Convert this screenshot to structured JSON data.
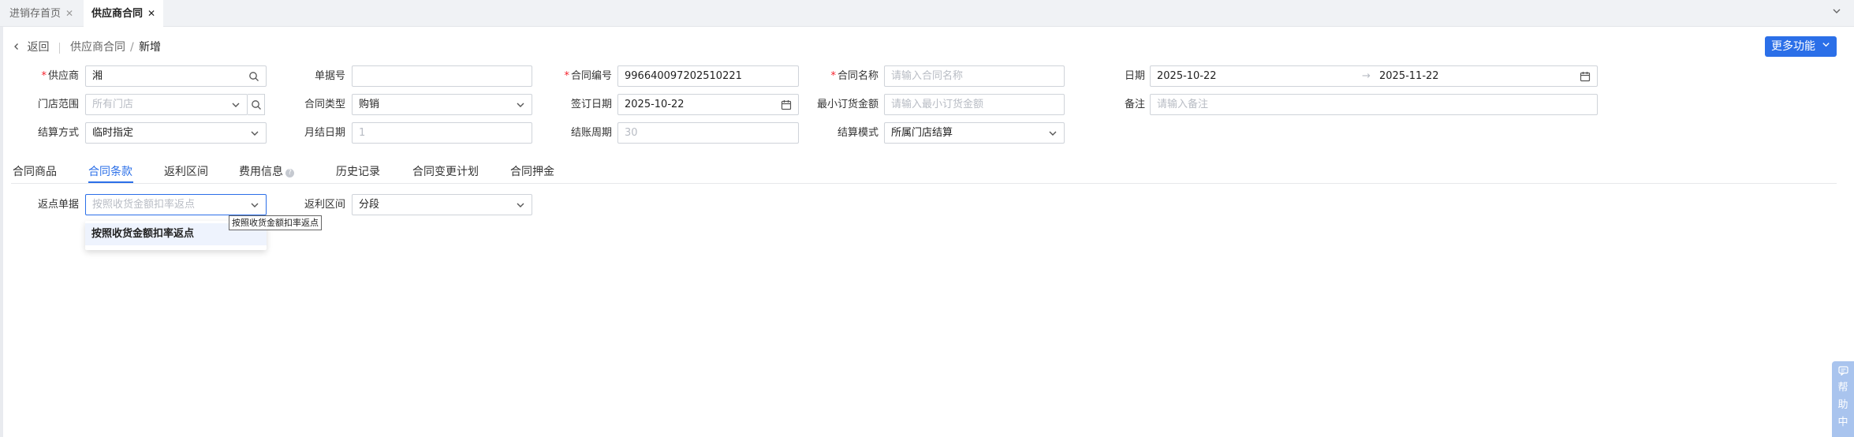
{
  "tabs": [
    {
      "label": "进销存首页",
      "active": false
    },
    {
      "label": "供应商合同",
      "active": true
    }
  ],
  "breadcrumb": {
    "back": "返回",
    "parent": "供应商合同",
    "separator": "/",
    "current": "新增"
  },
  "more_button": "更多功能",
  "form": {
    "supplier": {
      "label": "供应商",
      "value": "湘"
    },
    "doc_no": {
      "label": "单据号",
      "value": ""
    },
    "contract_no": {
      "label": "合同编号",
      "value": "996640097202510221"
    },
    "contract_name": {
      "label": "合同名称",
      "placeholder": "请输入合同名称"
    },
    "date": {
      "label": "日期",
      "start": "2025-10-22",
      "arrow": "→",
      "end": "2025-11-22"
    },
    "store_scope": {
      "label": "门店范围",
      "placeholder": "所有门店"
    },
    "contract_type": {
      "label": "合同类型",
      "value": "购销"
    },
    "sign_date": {
      "label": "签订日期",
      "value": "2025-10-22"
    },
    "min_order": {
      "label": "最小订货金额",
      "placeholder": "请输入最小订货金额"
    },
    "remark": {
      "label": "备注",
      "placeholder": "请输入备注"
    },
    "settle_method": {
      "label": "结算方式",
      "value": "临时指定"
    },
    "month_settle_day": {
      "label": "月结日期",
      "placeholder": "1"
    },
    "settle_period": {
      "label": "结账周期",
      "placeholder": "30"
    },
    "settle_mode": {
      "label": "结算模式",
      "value": "所属门店结算"
    }
  },
  "subtabs": [
    "合同商品",
    "合同条款",
    "返利区间",
    "费用信息",
    "历史记录",
    "合同变更计划",
    "合同押金"
  ],
  "active_subtab": "合同条款",
  "rebate": {
    "doc_label": "返点单据",
    "doc_placeholder": "按照收货金额扣率返点",
    "range_label": "返利区间",
    "range_value": "分段",
    "option": "按照收货金额扣率返点",
    "tooltip": "按照收货金额扣率返点"
  },
  "help": {
    "chars": [
      "帮",
      "助",
      "中"
    ]
  },
  "colors": {
    "primary": "#2b6fe8",
    "required": "#f5222d",
    "help": "#a9c4ee"
  }
}
